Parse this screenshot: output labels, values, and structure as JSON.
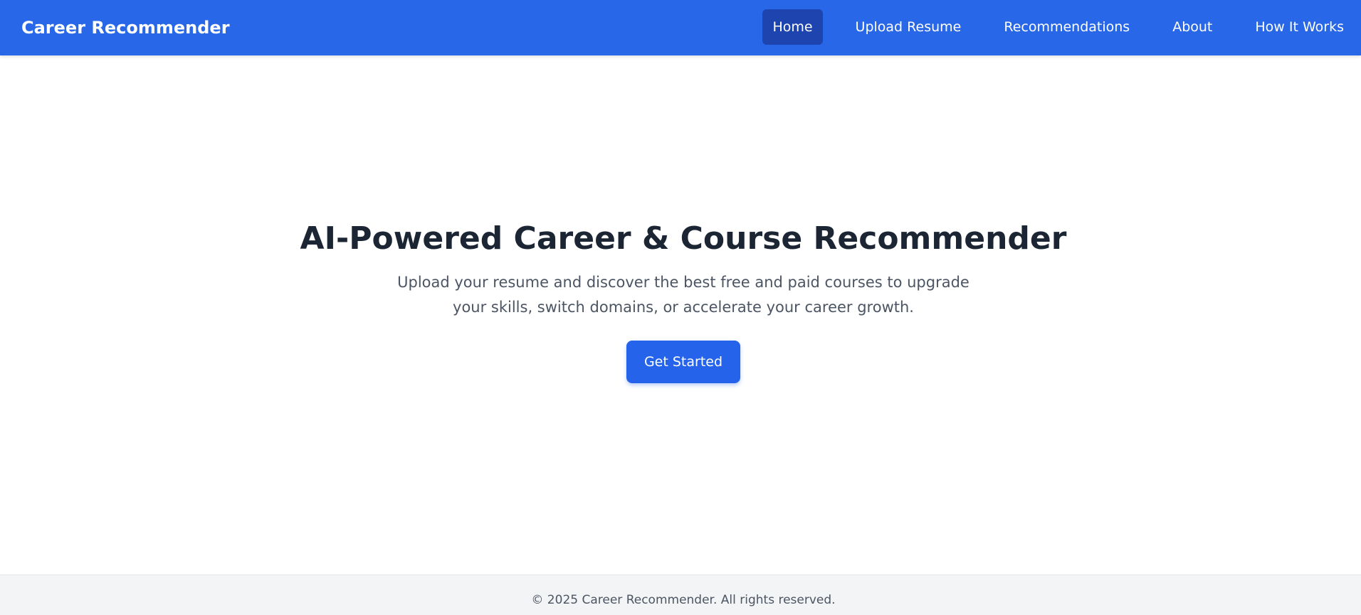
{
  "app": {
    "brand": "Career Recommender"
  },
  "nav": {
    "items": [
      {
        "label": "Home",
        "active": true
      },
      {
        "label": "Upload Resume",
        "active": false
      },
      {
        "label": "Recommendations",
        "active": false
      },
      {
        "label": "About",
        "active": false
      },
      {
        "label": "How It Works",
        "active": false
      }
    ]
  },
  "hero": {
    "title": "AI-Powered Career & Course Recommender",
    "subtitle": "Upload your resume and discover the best free and paid courses to upgrade your skills, switch domains, or accelerate your career growth.",
    "cta_label": "Get Started"
  },
  "footer": {
    "text": "© 2025 Career Recommender. All rights reserved."
  },
  "colors": {
    "navbar": "#2767e8",
    "nav_active": "#1e44b0",
    "button": "#2563eb",
    "title": "#1c2533",
    "body_text": "#4b5563",
    "footer_bg": "#f3f4f6"
  }
}
